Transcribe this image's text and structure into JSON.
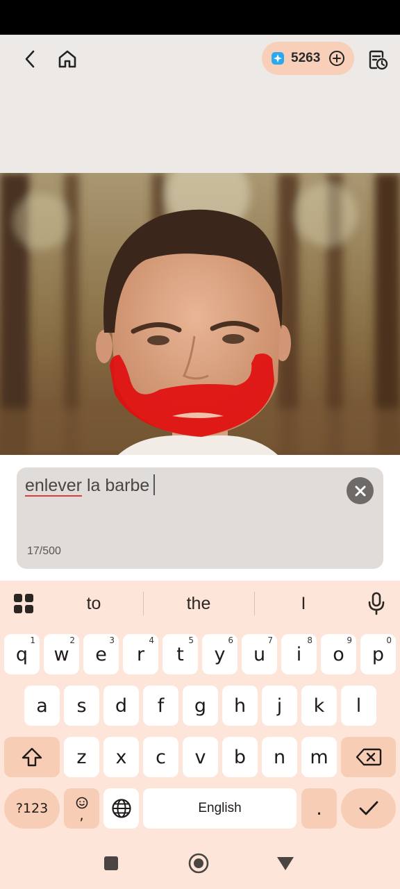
{
  "header": {
    "credits": "5263",
    "icons": {
      "back": "chevron-left-icon",
      "home": "home-icon",
      "gem": "diamond-icon",
      "add": "plus-circle-icon",
      "history": "history-icon"
    },
    "colors": {
      "pill_bg": "#f8cfb8",
      "gem": "#2aa8f0",
      "header_bg": "#ece9e6"
    }
  },
  "prompt": {
    "word1": "enlever",
    "rest": " la barbe",
    "char_count": "17/500"
  },
  "keyboard": {
    "suggestions": [
      "to",
      "the",
      "I"
    ],
    "row1": [
      {
        "k": "q",
        "n": "1"
      },
      {
        "k": "w",
        "n": "2"
      },
      {
        "k": "e",
        "n": "3"
      },
      {
        "k": "r",
        "n": "4"
      },
      {
        "k": "t",
        "n": "5"
      },
      {
        "k": "y",
        "n": "6"
      },
      {
        "k": "u",
        "n": "7"
      },
      {
        "k": "i",
        "n": "8"
      },
      {
        "k": "o",
        "n": "9"
      },
      {
        "k": "p",
        "n": "0"
      }
    ],
    "row2": [
      "a",
      "s",
      "d",
      "f",
      "g",
      "h",
      "j",
      "k",
      "l"
    ],
    "row3": [
      "z",
      "x",
      "c",
      "v",
      "b",
      "n",
      "m"
    ],
    "symbols_label": "?123",
    "comma_label": ",",
    "space_label": "English",
    "period_label": ".",
    "accent_color": "#f7cdb5",
    "background_color": "#fde6d9"
  }
}
